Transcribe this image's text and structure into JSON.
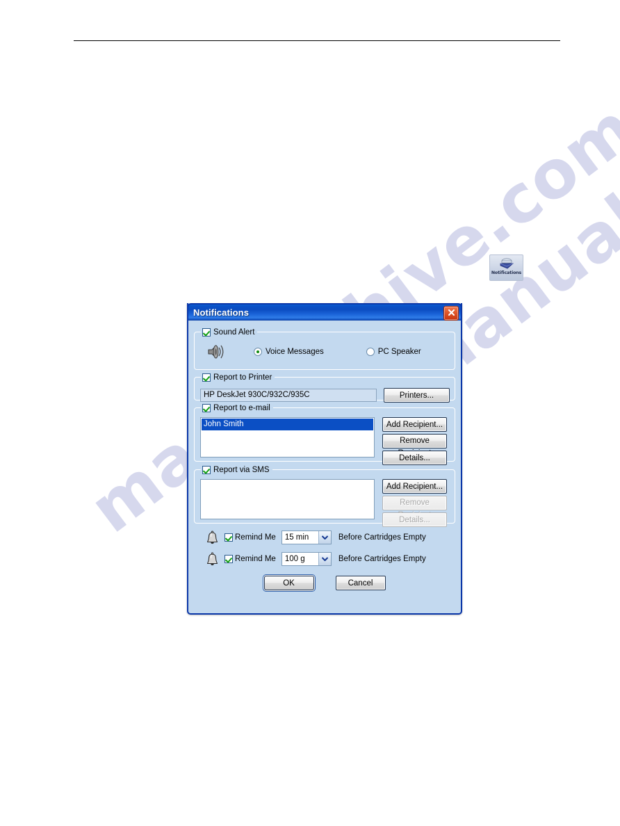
{
  "page": {
    "watermark_text": "manualshive.com"
  },
  "desktop_icon": {
    "name": "notifications-shortcut",
    "label": "Notifications"
  },
  "dialog": {
    "title": "Notifications",
    "close_tooltip": "Close",
    "sound": {
      "checkbox_label": "Sound Alert",
      "checked": true,
      "options": [
        {
          "label": "Voice Messages",
          "selected": true
        },
        {
          "label": "PC Speaker",
          "selected": false
        }
      ]
    },
    "printer": {
      "checkbox_label": "Report to Printer",
      "checked": true,
      "printer_value": "HP DeskJet 930C/932C/935C",
      "printers_button": "Printers..."
    },
    "email": {
      "checkbox_label": "Report to e-mail",
      "checked": true,
      "recipients": [
        "John Smith"
      ],
      "buttons": [
        {
          "label": "Add Recipient...",
          "disabled": false
        },
        {
          "label": "Remove Recipient",
          "disabled": false
        },
        {
          "label": "Details...",
          "disabled": false
        }
      ]
    },
    "sms": {
      "checkbox_label": "Report via SMS",
      "checked": true,
      "recipients": [],
      "buttons": [
        {
          "label": "Add Recipient...",
          "disabled": false
        },
        {
          "label": "Remove Recipient",
          "disabled": true
        },
        {
          "label": "Details...",
          "disabled": true
        }
      ]
    },
    "reminders": [
      {
        "checkbox_label": "Remind Me",
        "checked": true,
        "value": "15 min",
        "suffix": "Before Cartridges Empty"
      },
      {
        "checkbox_label": "Remind Me",
        "checked": true,
        "value": "100 g",
        "suffix": "Before Cartridges Empty"
      }
    ],
    "footer": {
      "ok_label": "OK",
      "cancel_label": "Cancel"
    }
  },
  "colors": {
    "title_bar_blue": "#0b4cc0",
    "dialog_face": "#c3d9ef",
    "selection_blue": "#0b4fc4",
    "check_green": "#12a012",
    "close_red": "#c9340d"
  }
}
